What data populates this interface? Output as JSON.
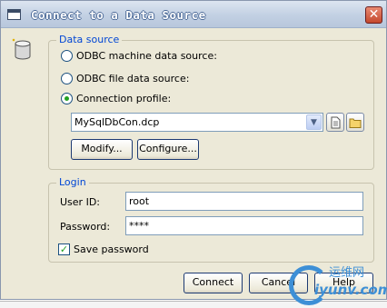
{
  "window": {
    "title": "Connect to a Data Source"
  },
  "data_source": {
    "legend": "Data source",
    "options": [
      {
        "label": "ODBC machine data source:",
        "selected": false
      },
      {
        "label": "ODBC file data source:",
        "selected": false
      },
      {
        "label": "Connection profile:",
        "selected": true
      }
    ],
    "profile_value": "MySqlDbCon.dcp",
    "modify_label": "Modify...",
    "configure_label": "Configure..."
  },
  "login": {
    "legend": "Login",
    "user_id_label": "User ID:",
    "user_id_value": "root",
    "password_label": "Password:",
    "password_value": "****",
    "save_password_label": "Save password",
    "save_password_checked": true
  },
  "buttons": {
    "connect": "Connect",
    "cancel": "Cancel",
    "help": "Help"
  },
  "watermark": {
    "text_cn": "运维网",
    "url": "iyunv.com"
  },
  "colors": {
    "dialog_bg": "#ece9d8",
    "group_title": "#0046d5",
    "close_button": "#c4482d",
    "radio_dot": "#21a121"
  },
  "icons": [
    "database-icon",
    "close-icon",
    "dropdown-arrow-icon",
    "new-file-icon",
    "open-folder-icon"
  ]
}
